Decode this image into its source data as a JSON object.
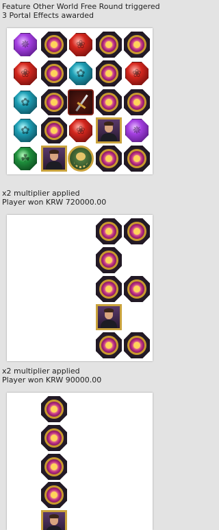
{
  "sections": [
    {
      "caption_lines": [
        "Feature Other World Free Round triggered",
        "3 Portal Effects awarded"
      ],
      "symbols": [
        [
          "purple-gem",
          "portal",
          "red-gem",
          "portal",
          "portal"
        ],
        [
          "red-gem",
          "portal",
          "teal-gem",
          "portal",
          "red-gem"
        ],
        [
          "teal-gem",
          "portal",
          "scatter",
          "portal",
          "portal"
        ],
        [
          "teal-gem",
          "portal",
          "red-gem",
          "portrait",
          "purple-gem"
        ],
        [
          "green-gem",
          "portrait",
          "wild",
          "portal",
          "portal"
        ]
      ]
    },
    {
      "caption_lines": [
        "x2 multiplier applied",
        "Player won KRW 720000.00"
      ],
      "symbols": [
        [
          "",
          "",
          "",
          "portal",
          "portal"
        ],
        [
          "",
          "",
          "",
          "portal",
          ""
        ],
        [
          "",
          "",
          "",
          "portal",
          "portal"
        ],
        [
          "",
          "",
          "",
          "portrait",
          ""
        ],
        [
          "",
          "",
          "",
          "portal",
          "portal"
        ]
      ]
    },
    {
      "caption_lines": [
        "x2 multiplier applied",
        "Player won KRW 90000.00"
      ],
      "symbols": [
        [
          "",
          "portal",
          "",
          "",
          ""
        ],
        [
          "",
          "portal",
          "",
          "",
          ""
        ],
        [
          "",
          "portal",
          "",
          "",
          ""
        ],
        [
          "",
          "portal",
          "",
          "",
          ""
        ],
        [
          "",
          "portrait",
          "",
          "",
          ""
        ]
      ]
    }
  ]
}
